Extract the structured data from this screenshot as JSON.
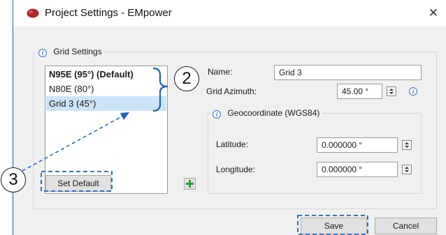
{
  "window": {
    "title": "Project Settings - EMpower",
    "close_glyph": "✕"
  },
  "grid_settings": {
    "group_title": "Grid Settings",
    "info_glyph": "i",
    "grid_list": [
      {
        "label": "N95E (95°) (Default)",
        "is_default": true,
        "selected": false
      },
      {
        "label": "N80E (80°)",
        "is_default": false,
        "selected": false
      },
      {
        "label": "Grid 3 (45°)",
        "is_default": false,
        "selected": true
      }
    ],
    "set_default_label": "Set Default",
    "add_grid_glyph": "+",
    "name_label": "Name:",
    "name_value": "Grid 3",
    "azimuth_label": "Grid Azimuth:",
    "azimuth_value": "45.00 °",
    "geocoordinate": {
      "group_title": "Geocoordinate (WGS84)",
      "latitude_label": "Latitude:",
      "latitude_value": "0.000000 °",
      "longitude_label": "Longitude:",
      "longitude_value": "0.000000 °"
    }
  },
  "footer": {
    "save_label": "Save",
    "cancel_label": "Cancel"
  },
  "callouts": {
    "callout_2": "2",
    "callout_3": "3"
  },
  "colors": {
    "accent_blue": "#1f5fbf",
    "selection_blue": "#cce4f7",
    "add_green": "#2f9a2f",
    "app_icon_red": "#b0282a"
  }
}
